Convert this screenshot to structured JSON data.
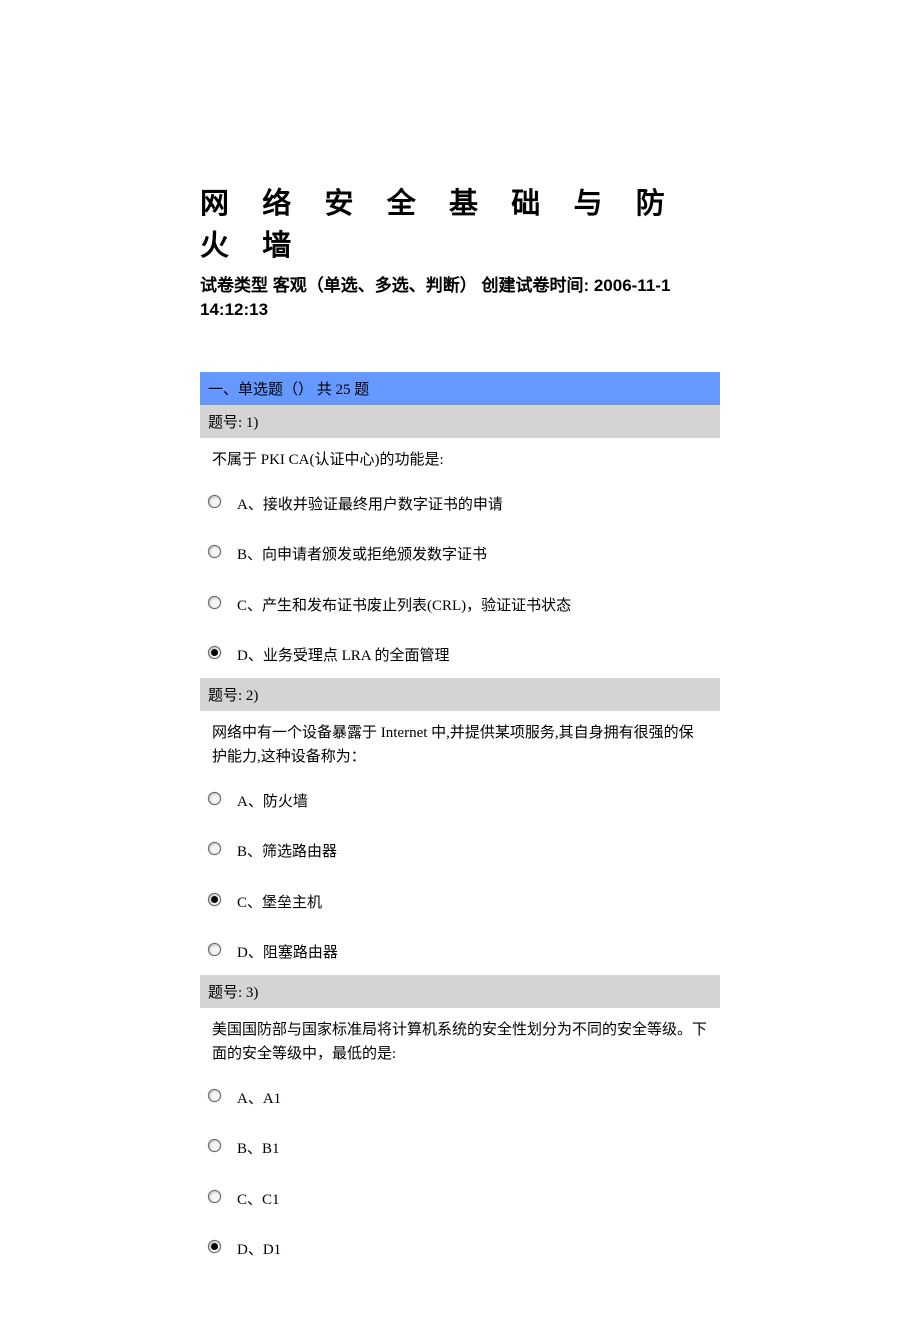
{
  "title": "网 络 安 全 基 础 与 防 火 墙",
  "meta_line1": "试卷类型 客观（单选、多选、判断）  创建试卷时间: 2006-11-1",
  "meta_line2": "14:12:13",
  "section_header": "一、单选题（） 共 25 题",
  "questions": [
    {
      "header": "题号: 1)",
      "text": "不属于 PKI CA(认证中心)的功能是:",
      "options": [
        {
          "label": "A、接收并验证最终用户数字证书的申请",
          "selected": false
        },
        {
          "label": "B、向申请者颁发或拒绝颁发数字证书",
          "selected": false
        },
        {
          "label": "C、产生和发布证书废止列表(CRL)，验证证书状态",
          "selected": false
        },
        {
          "label": "D、业务受理点 LRA 的全面管理",
          "selected": true
        }
      ]
    },
    {
      "header": "题号: 2)",
      "text": "网络中有一个设备暴露于 Internet 中,并提供某项服务,其自身拥有很强的保护能力,这种设备称为：",
      "options": [
        {
          "label": "A、防火墙",
          "selected": false
        },
        {
          "label": "B、筛选路由器",
          "selected": false
        },
        {
          "label": "C、堡垒主机",
          "selected": true
        },
        {
          "label": "D、阻塞路由器",
          "selected": false
        }
      ]
    },
    {
      "header": "题号: 3)",
      "text": "美国国防部与国家标准局将计算机系统的安全性划分为不同的安全等级。下面的安全等级中，最低的是:",
      "options": [
        {
          "label": "A、A1",
          "selected": false
        },
        {
          "label": "B、B1",
          "selected": false
        },
        {
          "label": "C、C1",
          "selected": false
        },
        {
          "label": "D、D1",
          "selected": true
        }
      ]
    }
  ]
}
